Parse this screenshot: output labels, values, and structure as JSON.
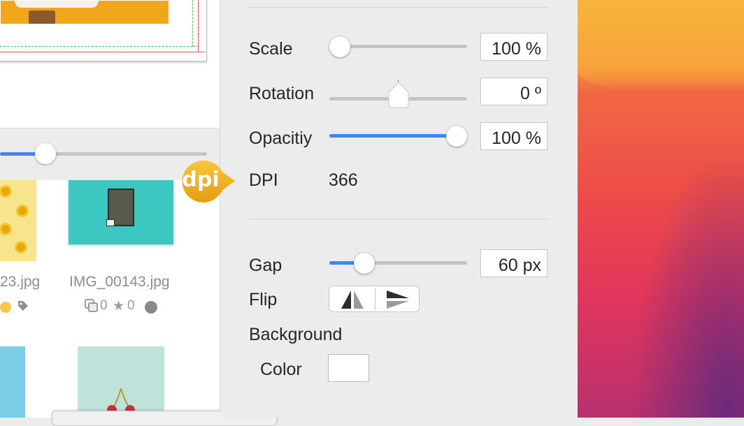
{
  "browser": {
    "thumbnails": [
      {
        "filename": "23.jpg"
      },
      {
        "filename": "IMG_00143.jpg",
        "meta": {
          "copies": "0",
          "stars": "0"
        }
      }
    ]
  },
  "badge": {
    "label": "dpi"
  },
  "inspector": {
    "scale": {
      "label": "Scale",
      "value": "100 %",
      "level": 0.0
    },
    "rotation": {
      "label": "Rotation",
      "value": "0 º",
      "level": 0.5
    },
    "opacity": {
      "label": "Opacitiy",
      "value": "100 %",
      "level": 1.0
    },
    "dpi": {
      "label": "DPI",
      "value": "366"
    },
    "gap": {
      "label": "Gap",
      "value": "60 px",
      "level": 0.25
    },
    "flip": {
      "label": "Flip",
      "options": [
        "flip-horizontal",
        "flip-vertical"
      ]
    },
    "background": {
      "label": "Background",
      "color_label": "Color",
      "color": "#ffffff"
    }
  },
  "colors": {
    "accent": "#3f86f0",
    "badge": "#f0a81c"
  }
}
